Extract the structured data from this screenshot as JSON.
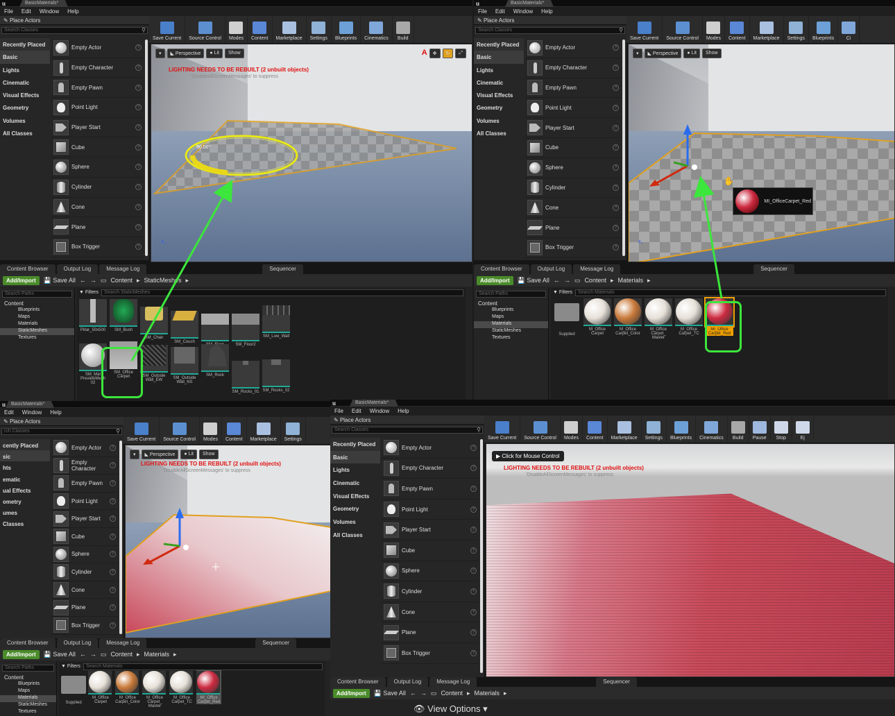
{
  "p1": {
    "window_tab": "BasicMaterials*",
    "menu": [
      "File",
      "Edit",
      "Window",
      "Help"
    ],
    "place_actors": "Place Actors",
    "search_classes": "Search Classes",
    "categories": [
      "Recently Placed",
      "Basic",
      "Lights",
      "Cinematic",
      "Visual Effects",
      "Geometry",
      "Volumes",
      "All Classes"
    ],
    "actors": [
      "Empty Actor",
      "Empty Character",
      "Empty Pawn",
      "Point Light",
      "Player Start",
      "Cube",
      "Sphere",
      "Cylinder",
      "Cone",
      "Plane",
      "Box Trigger"
    ],
    "toolbar": [
      "Save Current",
      "Source Control",
      "Modes",
      "Content",
      "Marketplace",
      "Settings",
      "Blueprints",
      "Cinematics",
      "Build"
    ],
    "view_perspective": "Perspective",
    "view_lit": "Lit",
    "view_show": "Show",
    "warning": "LIGHTING NEEDS TO BE REBUILT (2 unbuilt objects)",
    "hint": "'DisableAllScreenMessages' to suppress",
    "rotation_readout": "90.00°",
    "bottom_tabs": [
      "Content Browser",
      "Output Log",
      "Message Log",
      "Sequencer"
    ],
    "add_import": "Add/Import",
    "save_all": "Save All",
    "path": [
      "Content",
      "StaticMeshes"
    ],
    "search_paths": "Search Paths",
    "filters": "Filters",
    "search_assets": "Search StaticMeshes",
    "tree": [
      "Content",
      "Blueprints",
      "Maps",
      "Materials",
      "StaticMeshes",
      "Textures"
    ],
    "assets_row1": [
      "Pillar_50x500",
      "SM_Bush",
      "SM_Chair",
      "SM_Couch",
      "SM_Floor",
      "SM_Floor2",
      "SM_Low_Wall"
    ],
    "assets_row2": [
      "SM_Mat PreviewMesh 02",
      "SM_Office Carpet",
      "SM_Outside Wall_EW",
      "SM_Outside Wall_NS",
      "SM_Rock",
      "SM_Rocks_01",
      "SM_Rocks_02"
    ]
  },
  "p2": {
    "window_tab": "BasicMaterials*",
    "menu": [
      "File",
      "Edit",
      "Window",
      "Help"
    ],
    "place_actors": "Place Actors",
    "search_classes": "Search Classes",
    "categories": [
      "Recently Placed",
      "Basic",
      "Lights",
      "Cinematic",
      "Visual Effects",
      "Geometry",
      "Volumes",
      "All Classes"
    ],
    "actors": [
      "Empty Actor",
      "Empty Character",
      "Empty Pawn",
      "Point Light",
      "Player Start",
      "Cube",
      "Sphere",
      "Cylinder",
      "Cone",
      "Plane",
      "Box Trigger"
    ],
    "toolbar": [
      "Save Current",
      "Source Control",
      "Modes",
      "Content",
      "Marketplace",
      "Settings",
      "Blueprints",
      "Ci"
    ],
    "view_perspective": "Perspective",
    "view_lit": "Lit",
    "view_show": "Show",
    "tooltip": "MI_OfficeCarpet_Red",
    "bottom_tabs": [
      "Content Browser",
      "Output Log",
      "Message Log",
      "Sequencer"
    ],
    "add_import": "Add/Import",
    "save_all": "Save All",
    "path": [
      "Content",
      "Materials"
    ],
    "search_paths": "Search Paths",
    "filters": "Filters",
    "search_assets": "Search Materials",
    "tree": [
      "Content",
      "Blueprints",
      "Maps",
      "Materials",
      "StaticMeshes",
      "Textures"
    ],
    "assets": [
      "Supplied",
      "M_Office Carpet",
      "M_Office Carpet_Color",
      "M_Office Carpet_ Master",
      "M_Office Carpet_TC",
      "MI_Office Carpet_Red"
    ]
  },
  "p3": {
    "window_tab": "BasicMaterials*",
    "menu": [
      "Edit",
      "Window",
      "Help"
    ],
    "place_actors": "Place Actors",
    "search_classes": "rch Classes",
    "categories": [
      "cently Placed",
      "sic",
      "hts",
      "ematic",
      "ual Effects",
      "ometry",
      "umes",
      "Classes"
    ],
    "actors": [
      "Empty Actor",
      "Empty Character",
      "Empty Pawn",
      "Point Light",
      "Player Start",
      "Cube",
      "Sphere",
      "Cylinder",
      "Cone",
      "Plane",
      "Box Trigger"
    ],
    "toolbar": [
      "Save Current",
      "Source Control",
      "Modes",
      "Content",
      "Marketplace",
      "Settings"
    ],
    "view_perspective": "Perspective",
    "view_lit": "Lit",
    "view_show": "Show",
    "warning": "LIGHTING NEEDS TO BE REBUILT (2 unbuilt objects)",
    "hint": "'DisableAllScreenMessages' to suppress",
    "bottom_tabs": [
      "Content Browser",
      "Output Log",
      "Message Log",
      "Sequencer"
    ],
    "add_import": "Add/Import",
    "save_all": "Save All",
    "path": [
      "Content",
      "Materials"
    ],
    "search_paths": "Search Paths",
    "filters": "Filters",
    "search_assets": "Search Materials",
    "tree": [
      "Content",
      "Blueprints",
      "Maps",
      "Materials",
      "StaticMeshes",
      "Textures"
    ],
    "assets": [
      "Supplied",
      "M_Office Carpet",
      "M_Office Carpet_Color",
      "M_Office Carpet_ Master",
      "M_Office Carpet_TC",
      "MI_Office Carpet_Red"
    ]
  },
  "p4": {
    "window_tab": "BasicMaterials*",
    "menu": [
      "File",
      "Edit",
      "Window",
      "Help"
    ],
    "place_actors": "Place Actors",
    "search_classes": "Search Classes",
    "categories": [
      "Recently Placed",
      "Basic",
      "Lights",
      "Cinematic",
      "Visual Effects",
      "Geometry",
      "Volumes",
      "All Classes"
    ],
    "actors": [
      "Empty Actor",
      "Empty Character",
      "Empty Pawn",
      "Point Light",
      "Player Start",
      "Cube",
      "Sphere",
      "Cylinder",
      "Cone",
      "Plane",
      "Box Trigger"
    ],
    "toolbar": [
      "Save Current",
      "Source Control",
      "Modes",
      "Content",
      "Marketplace",
      "Settings",
      "Blueprints",
      "Cinematics",
      "Build",
      "Pause",
      "Stop",
      "Ej"
    ],
    "mouse_control": "Click for Mouse Control",
    "warning": "LIGHTING NEEDS TO BE REBUILT (2 unbuilt objects)",
    "hint": "'DisableAllScreenMessages' to suppress",
    "bottom_tabs": [
      "Content Browser",
      "Output Log",
      "Message Log",
      "Sequencer"
    ],
    "add_import": "Add/Import",
    "save_all": "Save All",
    "path": [
      "Content",
      "Materials"
    ],
    "view_options": "View Options"
  },
  "colors": {
    "accent_green": "#3ce63c",
    "warning_red": "#e01010",
    "carpet_red": "#c84a5a",
    "add_button": "#4a8b2a"
  }
}
